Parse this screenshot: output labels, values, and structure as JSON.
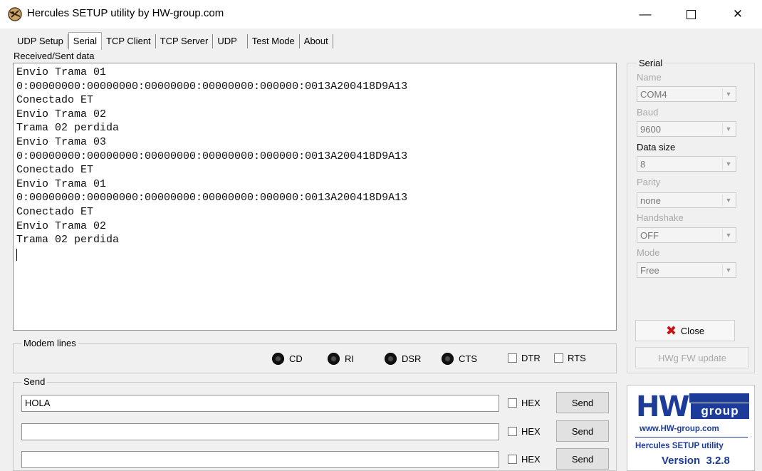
{
  "window": {
    "title": "Hercules SETUP utility by HW-group.com",
    "controls": {
      "minimize": "—",
      "close": "✕"
    }
  },
  "tabs": [
    {
      "label": "UDP Setup",
      "active": false
    },
    {
      "label": "Serial",
      "active": true
    },
    {
      "label": "TCP Client",
      "active": false
    },
    {
      "label": "TCP Server",
      "active": false
    },
    {
      "label": "UDP",
      "active": false
    },
    {
      "label": "Test Mode",
      "active": false
    },
    {
      "label": "About",
      "active": false
    }
  ],
  "received": {
    "label": "Received/Sent data",
    "lines": [
      "Envio Trama 01",
      "0:00000000:00000000:00000000:00000000:000000:0013A200418D9A13",
      "Conectado ET",
      "Envio Trama 02",
      "Trama 02 perdida",
      "Envio Trama 03",
      "0:00000000:00000000:00000000:00000000:000000:0013A200418D9A13",
      "Conectado ET",
      "Envio Trama 01",
      "0:00000000:00000000:00000000:00000000:000000:0013A200418D9A13",
      "Conectado ET",
      "Envio Trama 02",
      "Trama 02 perdida"
    ]
  },
  "modem": {
    "title": "Modem lines",
    "leds": [
      "CD",
      "RI",
      "DSR",
      "CTS"
    ],
    "checkboxes": [
      "DTR",
      "RTS"
    ]
  },
  "serial": {
    "title": "Serial",
    "name_label": "Name",
    "name_value": "COM4",
    "baud_label": "Baud",
    "baud_value": "9600",
    "datasize_label": "Data size",
    "datasize_value": "8",
    "parity_label": "Parity",
    "parity_value": "none",
    "handshake_label": "Handshake",
    "handshake_value": "OFF",
    "mode_label": "Mode",
    "mode_value": "Free",
    "close_label": "Close",
    "hwg_label": "HWg FW update"
  },
  "send": {
    "title": "Send",
    "rows": [
      {
        "value": "HOLA",
        "hex_label": "HEX",
        "button": "Send"
      },
      {
        "value": "",
        "hex_label": "HEX",
        "button": "Send"
      },
      {
        "value": "",
        "hex_label": "HEX",
        "button": "Send"
      }
    ]
  },
  "logo": {
    "hw": "HW",
    "group": "group",
    "url": "www.HW-group.com",
    "app": "Hercules SETUP utility",
    "version": "Version  3.2.8",
    "brand_color": "#1d3c9a"
  }
}
